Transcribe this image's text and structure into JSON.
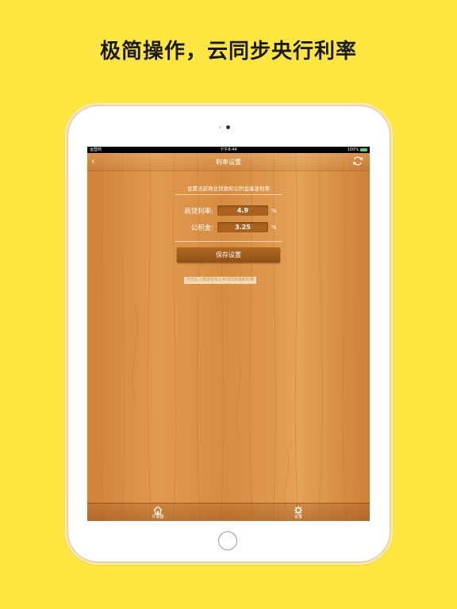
{
  "headline": "极简操作，云同步央行利率",
  "status_bar": {
    "carrier": "运营商",
    "time": "下午8:44",
    "battery": "100%"
  },
  "nav": {
    "title": "利率设置",
    "back_icon": "chevron-left-icon",
    "refresh_icon": "refresh-icon"
  },
  "intro": "设置当前商业贷款和公积金基准利率",
  "rates": [
    {
      "label": "商贷利率:",
      "value": "4.9",
      "unit": "%"
    },
    {
      "label": "公积金:",
      "value": "3.25",
      "unit": "%"
    }
  ],
  "save_label": "保存设置",
  "tip": "点击右上角按钮可以手动同步最新利率",
  "tabs": [
    {
      "label": "计算器",
      "icon": "home-icon"
    },
    {
      "label": "设置",
      "icon": "gear-icon"
    }
  ],
  "colors": {
    "background": "#FFE640",
    "wood": "#d68a3c",
    "button": "#9a5619"
  }
}
